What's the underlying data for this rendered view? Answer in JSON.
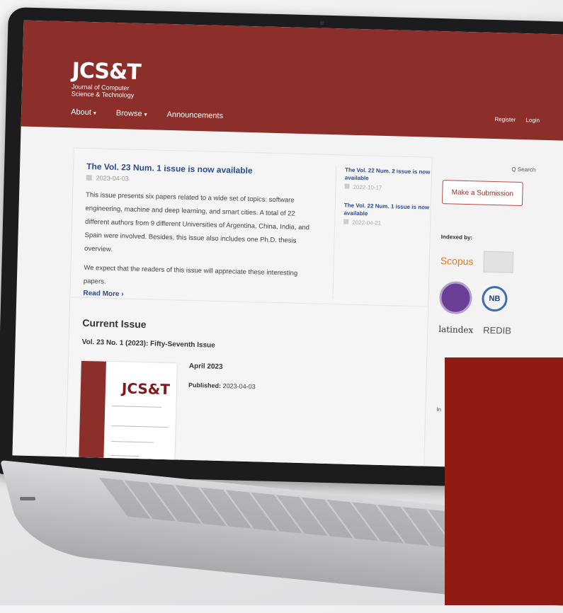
{
  "site": {
    "logo_main": "JCS&T",
    "logo_sub": "Journal of Computer Science & Technology",
    "user_nav": [
      "Register",
      "Login"
    ],
    "main_nav": [
      {
        "label": "About",
        "dropdown": true
      },
      {
        "label": "Browse",
        "dropdown": true
      },
      {
        "label": "Announcements",
        "dropdown": false
      }
    ],
    "search_label": "Q Search",
    "header_color": "#8c2f2b"
  },
  "announcement_lead": {
    "title": "The Vol. 23 Num. 1 issue is now available",
    "date": "2023-04-03",
    "body_1": "This issue presents six papers related to a wide set of topics: software engineering, machine and deep learning, and smart cities. A total of 22 different authors from 9 different Universities of Argentina, China, India, and Spain were involved. Besides, this issue also includes one Ph.D. thesis overview.",
    "body_2": "We expect that the readers of this issue will appreciate these interesting papers.",
    "read_more": "Read More ›"
  },
  "announcements": [
    {
      "title": "The Vol. 22 Num. 2 issue is now available",
      "date": "2022-10-17"
    },
    {
      "title": "The Vol. 22 Num. 1 issue is now available",
      "date": "2022-04-21"
    }
  ],
  "current_issue": {
    "heading": "Current Issue",
    "volume": "Vol. 23 No. 1 (2023): Fifty-Seventh Issue",
    "cover_logo": "JCS&T",
    "issue_date": "April 2023",
    "published_label": "Published:",
    "published_date": "2023-04-03"
  },
  "sidebar": {
    "submit_label": "Make a Submission",
    "indexed_label": "Indexed by:",
    "scopus": "Scopus",
    "nb": "NB",
    "latindex": "latindex",
    "redib": "REDIB",
    "more_label": "In"
  },
  "colors": {
    "overlay_red": "#8e1c12",
    "link_blue": "#2b4c8c"
  }
}
